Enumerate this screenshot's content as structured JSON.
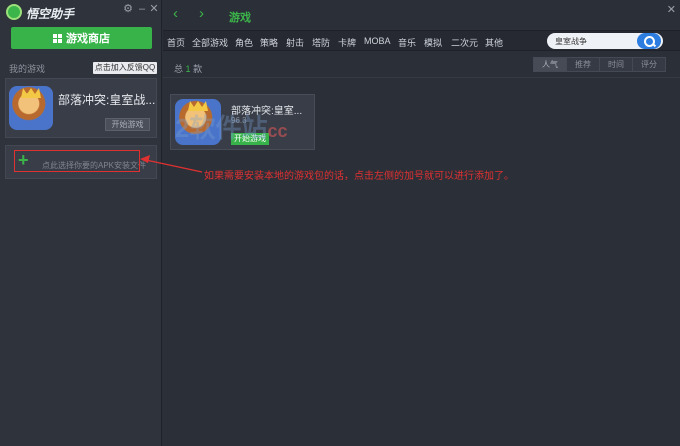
{
  "app": {
    "logo_text": "悟空助手",
    "settings_icon": "gear-icon",
    "minimize_glyph": "–",
    "close_glyph": "✕"
  },
  "sidebar": {
    "store_button": "游戏商店",
    "my_games_label": "我的游戏",
    "qq_group_button": "点击加入反馈QQ群",
    "game": {
      "title": "部落冲突:皇室战...",
      "start_button": "开始游戏"
    },
    "add_apk_label": "点此选择你要的APK安装文件"
  },
  "topbar": {
    "title": "游戏",
    "back_glyph": "‹",
    "forward_glyph": "›",
    "close_glyph": "✕"
  },
  "categories": [
    "首页",
    "全部游戏",
    "角色",
    "策略",
    "射击",
    "塔防",
    "卡牌",
    "MOBA",
    "音乐",
    "模拟",
    "二次元",
    "其他"
  ],
  "search": {
    "value": "皇室战争"
  },
  "results": {
    "total_prefix": "总",
    "total_count": "1",
    "total_suffix": "款",
    "sort_options": [
      "人气",
      "推荐",
      "时间",
      "评分"
    ],
    "active_sort": "人气"
  },
  "result_card": {
    "title": "部落冲突:皇室...",
    "size": "96.3",
    "start_button": "开始游戏"
  },
  "watermark": {
    "text": "2软件站",
    "suffix": "cc"
  },
  "annotation": "如果需要安装本地的游戏包的话，点击左侧的加号就可以进行添加了。",
  "colors": {
    "accent": "#3bb54a",
    "annotation": "#e03131",
    "search_button": "#2d7de0"
  }
}
